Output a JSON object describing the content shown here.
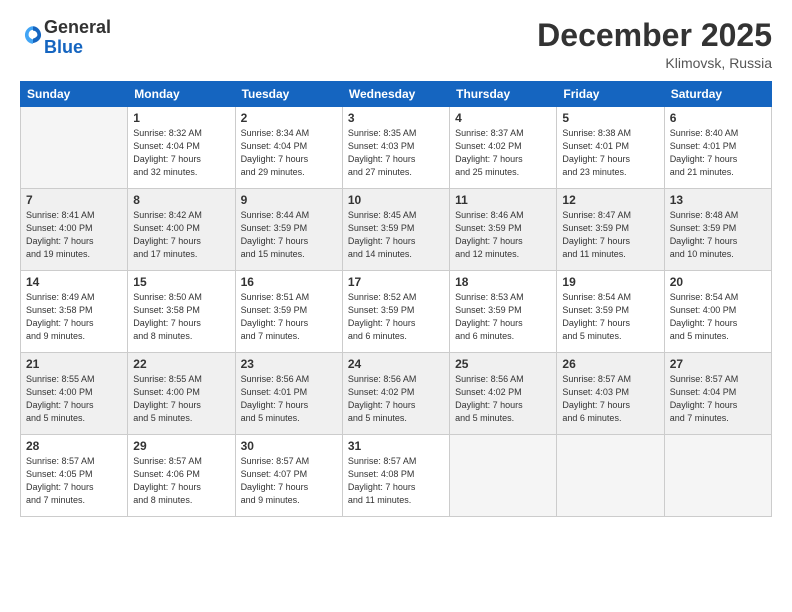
{
  "logo": {
    "general": "General",
    "blue": "Blue"
  },
  "header": {
    "month": "December 2025",
    "location": "Klimovsk, Russia"
  },
  "days_of_week": [
    "Sunday",
    "Monday",
    "Tuesday",
    "Wednesday",
    "Thursday",
    "Friday",
    "Saturday"
  ],
  "weeks": [
    [
      {
        "day": "",
        "info": ""
      },
      {
        "day": "1",
        "info": "Sunrise: 8:32 AM\nSunset: 4:04 PM\nDaylight: 7 hours\nand 32 minutes."
      },
      {
        "day": "2",
        "info": "Sunrise: 8:34 AM\nSunset: 4:04 PM\nDaylight: 7 hours\nand 29 minutes."
      },
      {
        "day": "3",
        "info": "Sunrise: 8:35 AM\nSunset: 4:03 PM\nDaylight: 7 hours\nand 27 minutes."
      },
      {
        "day": "4",
        "info": "Sunrise: 8:37 AM\nSunset: 4:02 PM\nDaylight: 7 hours\nand 25 minutes."
      },
      {
        "day": "5",
        "info": "Sunrise: 8:38 AM\nSunset: 4:01 PM\nDaylight: 7 hours\nand 23 minutes."
      },
      {
        "day": "6",
        "info": "Sunrise: 8:40 AM\nSunset: 4:01 PM\nDaylight: 7 hours\nand 21 minutes."
      }
    ],
    [
      {
        "day": "7",
        "info": "Sunrise: 8:41 AM\nSunset: 4:00 PM\nDaylight: 7 hours\nand 19 minutes."
      },
      {
        "day": "8",
        "info": "Sunrise: 8:42 AM\nSunset: 4:00 PM\nDaylight: 7 hours\nand 17 minutes."
      },
      {
        "day": "9",
        "info": "Sunrise: 8:44 AM\nSunset: 3:59 PM\nDaylight: 7 hours\nand 15 minutes."
      },
      {
        "day": "10",
        "info": "Sunrise: 8:45 AM\nSunset: 3:59 PM\nDaylight: 7 hours\nand 14 minutes."
      },
      {
        "day": "11",
        "info": "Sunrise: 8:46 AM\nSunset: 3:59 PM\nDaylight: 7 hours\nand 12 minutes."
      },
      {
        "day": "12",
        "info": "Sunrise: 8:47 AM\nSunset: 3:59 PM\nDaylight: 7 hours\nand 11 minutes."
      },
      {
        "day": "13",
        "info": "Sunrise: 8:48 AM\nSunset: 3:59 PM\nDaylight: 7 hours\nand 10 minutes."
      }
    ],
    [
      {
        "day": "14",
        "info": "Sunrise: 8:49 AM\nSunset: 3:58 PM\nDaylight: 7 hours\nand 9 minutes."
      },
      {
        "day": "15",
        "info": "Sunrise: 8:50 AM\nSunset: 3:58 PM\nDaylight: 7 hours\nand 8 minutes."
      },
      {
        "day": "16",
        "info": "Sunrise: 8:51 AM\nSunset: 3:59 PM\nDaylight: 7 hours\nand 7 minutes."
      },
      {
        "day": "17",
        "info": "Sunrise: 8:52 AM\nSunset: 3:59 PM\nDaylight: 7 hours\nand 6 minutes."
      },
      {
        "day": "18",
        "info": "Sunrise: 8:53 AM\nSunset: 3:59 PM\nDaylight: 7 hours\nand 6 minutes."
      },
      {
        "day": "19",
        "info": "Sunrise: 8:54 AM\nSunset: 3:59 PM\nDaylight: 7 hours\nand 5 minutes."
      },
      {
        "day": "20",
        "info": "Sunrise: 8:54 AM\nSunset: 4:00 PM\nDaylight: 7 hours\nand 5 minutes."
      }
    ],
    [
      {
        "day": "21",
        "info": "Sunrise: 8:55 AM\nSunset: 4:00 PM\nDaylight: 7 hours\nand 5 minutes."
      },
      {
        "day": "22",
        "info": "Sunrise: 8:55 AM\nSunset: 4:00 PM\nDaylight: 7 hours\nand 5 minutes."
      },
      {
        "day": "23",
        "info": "Sunrise: 8:56 AM\nSunset: 4:01 PM\nDaylight: 7 hours\nand 5 minutes."
      },
      {
        "day": "24",
        "info": "Sunrise: 8:56 AM\nSunset: 4:02 PM\nDaylight: 7 hours\nand 5 minutes."
      },
      {
        "day": "25",
        "info": "Sunrise: 8:56 AM\nSunset: 4:02 PM\nDaylight: 7 hours\nand 5 minutes."
      },
      {
        "day": "26",
        "info": "Sunrise: 8:57 AM\nSunset: 4:03 PM\nDaylight: 7 hours\nand 6 minutes."
      },
      {
        "day": "27",
        "info": "Sunrise: 8:57 AM\nSunset: 4:04 PM\nDaylight: 7 hours\nand 7 minutes."
      }
    ],
    [
      {
        "day": "28",
        "info": "Sunrise: 8:57 AM\nSunset: 4:05 PM\nDaylight: 7 hours\nand 7 minutes."
      },
      {
        "day": "29",
        "info": "Sunrise: 8:57 AM\nSunset: 4:06 PM\nDaylight: 7 hours\nand 8 minutes."
      },
      {
        "day": "30",
        "info": "Sunrise: 8:57 AM\nSunset: 4:07 PM\nDaylight: 7 hours\nand 9 minutes."
      },
      {
        "day": "31",
        "info": "Sunrise: 8:57 AM\nSunset: 4:08 PM\nDaylight: 7 hours\nand 11 minutes."
      },
      {
        "day": "",
        "info": ""
      },
      {
        "day": "",
        "info": ""
      },
      {
        "day": "",
        "info": ""
      }
    ]
  ]
}
